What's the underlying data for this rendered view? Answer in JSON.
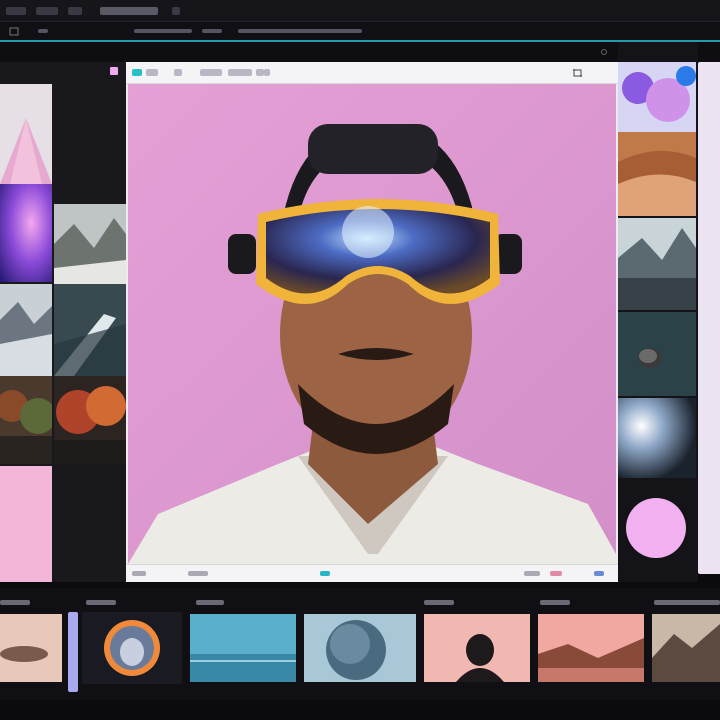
{
  "window": {
    "tabs": [
      {
        "name": "tab-1"
      },
      {
        "name": "tab-2"
      },
      {
        "name": "tab-3"
      },
      {
        "name": "tab-4"
      },
      {
        "name": "tab-5"
      }
    ]
  },
  "editor": {
    "toolbar_icons": [
      "crop-icon",
      "select-icon",
      "link-icon",
      "eye-icon",
      "expand-icon"
    ],
    "active_tool_color": "#28c0c8"
  },
  "colors": {
    "accent": "#2bb3c9",
    "canvas_bg": "#e5a0d6",
    "swatch": "#f2b0f0",
    "scroll_handle": "#a9a9f0"
  },
  "icons": [
    "settings-icon",
    "crop-icon",
    "close-icon"
  ]
}
